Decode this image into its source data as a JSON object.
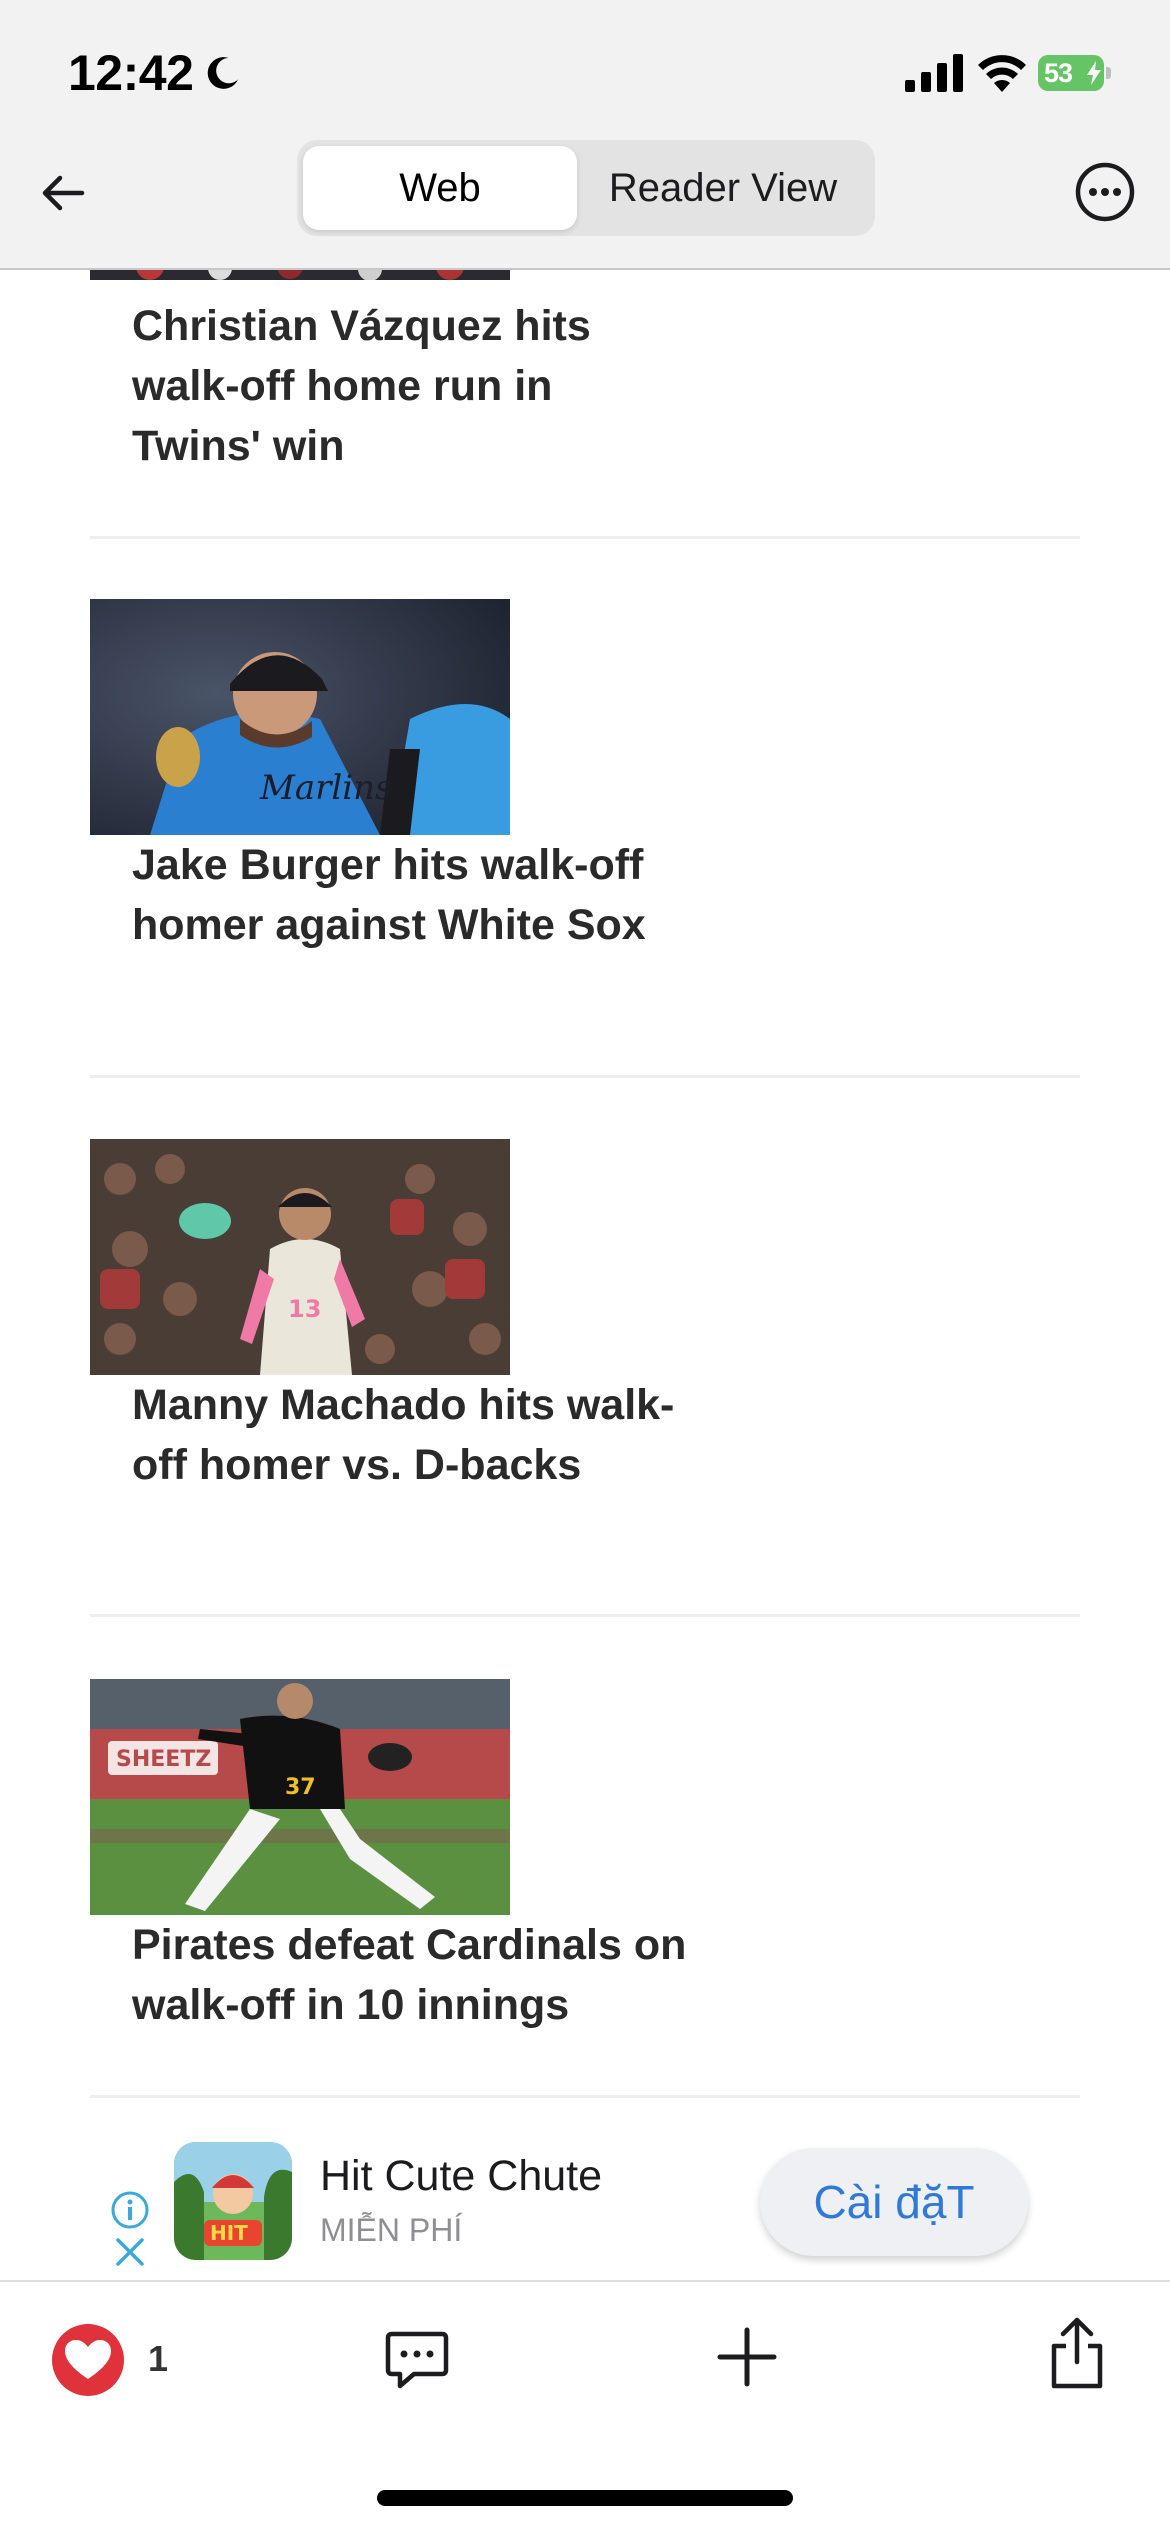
{
  "status_bar": {
    "time": "12:42",
    "battery_percent": "53",
    "icons": [
      "moon-icon",
      "signal-icon",
      "wifi-icon",
      "battery-charging-icon"
    ]
  },
  "nav": {
    "back_icon": "arrow-left-icon",
    "tabs": [
      {
        "label": "Web",
        "selected": true
      },
      {
        "label": "Reader View",
        "selected": false
      }
    ],
    "more_icon": "ellipsis-circle-icon"
  },
  "articles": [
    {
      "headline": "Christian Vázquez hits walk-off home run in Twins' win"
    },
    {
      "headline": "Jake Burger hits walk-off homer against White Sox"
    },
    {
      "headline": "Manny Machado hits walk-off homer vs. D-backs"
    },
    {
      "headline": "Pirates defeat Cardinals on walk-off in 10 innings"
    }
  ],
  "ad": {
    "app_name": "Hit Cute Chute",
    "price_label": "MIỄN PHÍ",
    "install_label": "Cài đặT",
    "icon_text": "HIT"
  },
  "toolbar": {
    "like_count": "1",
    "icons": [
      "heart-icon",
      "comment-icon",
      "plus-icon",
      "share-icon"
    ]
  },
  "colors": {
    "accent_blue": "#2f7ad8",
    "heart_red": "#e0323a",
    "battery_green": "#65c466"
  }
}
